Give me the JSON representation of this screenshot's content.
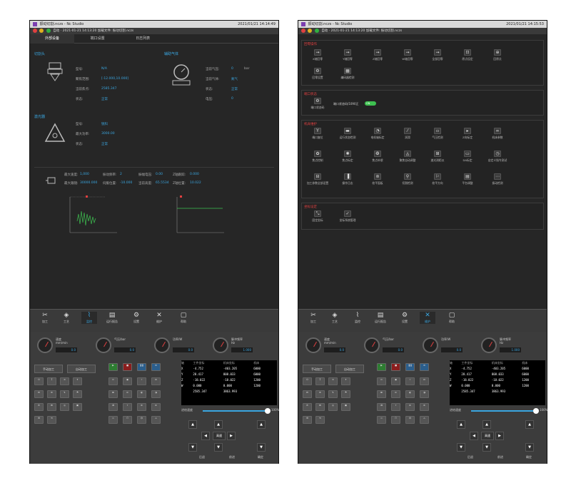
{
  "screenshots": [
    {
      "title": "振动切割.nczs - Nc Studio",
      "datetime": "2021/01/21 14:14:49",
      "toolbar_text": "自动 · 2021-01-21 14:13:20  加载文件: 振动切割.nczs",
      "tabs": [
        "外部设备",
        "端口设置",
        "日志列表"
      ]
    },
    {
      "title": "振动切割.nczs - Nc Studio",
      "datetime": "2021/01/21 14:15:53",
      "toolbar_text": "自动 · 2021-01-21 14:13:20  加载文件: 振动切割.nczs"
    }
  ],
  "left": {
    "cut_head": {
      "title": "切割头",
      "rows": [
        {
          "label": "型号:",
          "value": "N/A"
        },
        {
          "label": "聚焦范围:",
          "value": "[-12.000,10.000]"
        },
        {
          "label": "当前焦点:",
          "value": "2585.347"
        },
        {
          "label": "状态:",
          "value": "正常"
        }
      ]
    },
    "aux_gas": {
      "title": "辅助气体",
      "rows": [
        {
          "label": "当前气压:",
          "value": "0",
          "unit": "bar"
        },
        {
          "label": "当前气体:",
          "value": "氮气"
        },
        {
          "label": "状态:",
          "value": "正常"
        },
        {
          "label": "电压:",
          "value": "0"
        }
      ]
    },
    "laser": {
      "title": "激光器",
      "rows": [
        {
          "label": "型号:",
          "value": "锐科"
        },
        {
          "label": "最大功率:",
          "value": "3000.00"
        },
        {
          "label": "状态:",
          "value": "正常"
        }
      ]
    },
    "motion": {
      "row1": [
        {
          "label": "最大速度:",
          "value": "1,000"
        },
        {
          "label": "振动频率:",
          "value": "2"
        },
        {
          "label": "振幅电压:",
          "value": "0.00"
        },
        {
          "label": "Z轴跟踪:",
          "value": "0.000"
        }
      ],
      "row2": [
        {
          "label": "最大跟随:",
          "value": "30000.000"
        },
        {
          "label": "伺服位置:",
          "value": "-10.000"
        },
        {
          "label": "当前高度:",
          "value": "65.5534"
        },
        {
          "label": "Z轴位置:",
          "value": "10.022"
        }
      ]
    },
    "nav_labels": [
      "加工",
      "工艺",
      "监控",
      "运行报告",
      "设置",
      "维护",
      "帮助"
    ],
    "nav_active": 2
  },
  "right": {
    "panel1": {
      "title": "回零操作",
      "items": [
        "X轴回零",
        "Y轴回零",
        "Z轴回零",
        "W轴回零",
        "全部回零",
        "原点设定",
        "回原点",
        "回零设置",
        "编码器检测"
      ]
    },
    "panel2": {
      "title": "端口状态",
      "items": [
        "端口状态码"
      ],
      "toggle_text": "端口状态码/1090正",
      "toggle_state": "ON"
    },
    "panel3": {
      "title": "机床维护",
      "items": [
        "端口复位",
        "运行状态检测",
        "电机轴标定",
        "润滑",
        "气压检测",
        "Z向标定",
        "机床参数",
        "焦点控制",
        "焦点标定",
        "焦点补偿",
        "聚焦自动调整",
        "激光测距仪",
        "DA标定",
        "自定义指令测试",
        "加工参数全部设置",
        "操作日志",
        "校平面板",
        "切割检测",
        "校平方向",
        "平台调整",
        "振动检测"
      ]
    },
    "panel4": {
      "title": "坐标设定",
      "items": [
        "固定坐标",
        "坐标系统管理"
      ]
    },
    "nav_labels": [
      "加工",
      "工艺",
      "监控",
      "运行报告",
      "设置",
      "维护",
      "帮助"
    ],
    "nav_active": 5
  },
  "bottom": {
    "gauges": [
      {
        "label": "速度",
        "unit": "mm/min",
        "value": "0.0"
      },
      {
        "label": "气压/bar",
        "value": "0.0"
      },
      {
        "label": "功率/W",
        "value": "0.0"
      },
      {
        "label": "脉冲频率",
        "unit": "Hz",
        "value": "1.000"
      }
    ],
    "mode_buttons": [
      "手动加工",
      "自动加工"
    ],
    "coord_header": [
      "轴",
      "工件坐标",
      "机床坐标",
      "机床"
    ],
    "coords": [
      {
        "axis": "X",
        "work": "-4.752",
        "machine": "-403.205",
        "speed": "6000"
      },
      {
        "axis": "Y",
        "work": "28.417",
        "machine": "808.033",
        "speed": "6000"
      },
      {
        "axis": "Z",
        "work": "-18.022",
        "machine": "-18.022",
        "speed": "1200"
      },
      {
        "axis": "W",
        "work": "0.000",
        "machine": "0.000",
        "speed": "1200"
      },
      {
        "axis": "",
        "work": "2585.347",
        "machine": "3863.993",
        "speed": ""
      }
    ],
    "slider_label": "进给速度",
    "slider_pct": "100%",
    "jog_center": "高速",
    "footer": [
      "后退",
      "前进",
      "确定"
    ]
  }
}
